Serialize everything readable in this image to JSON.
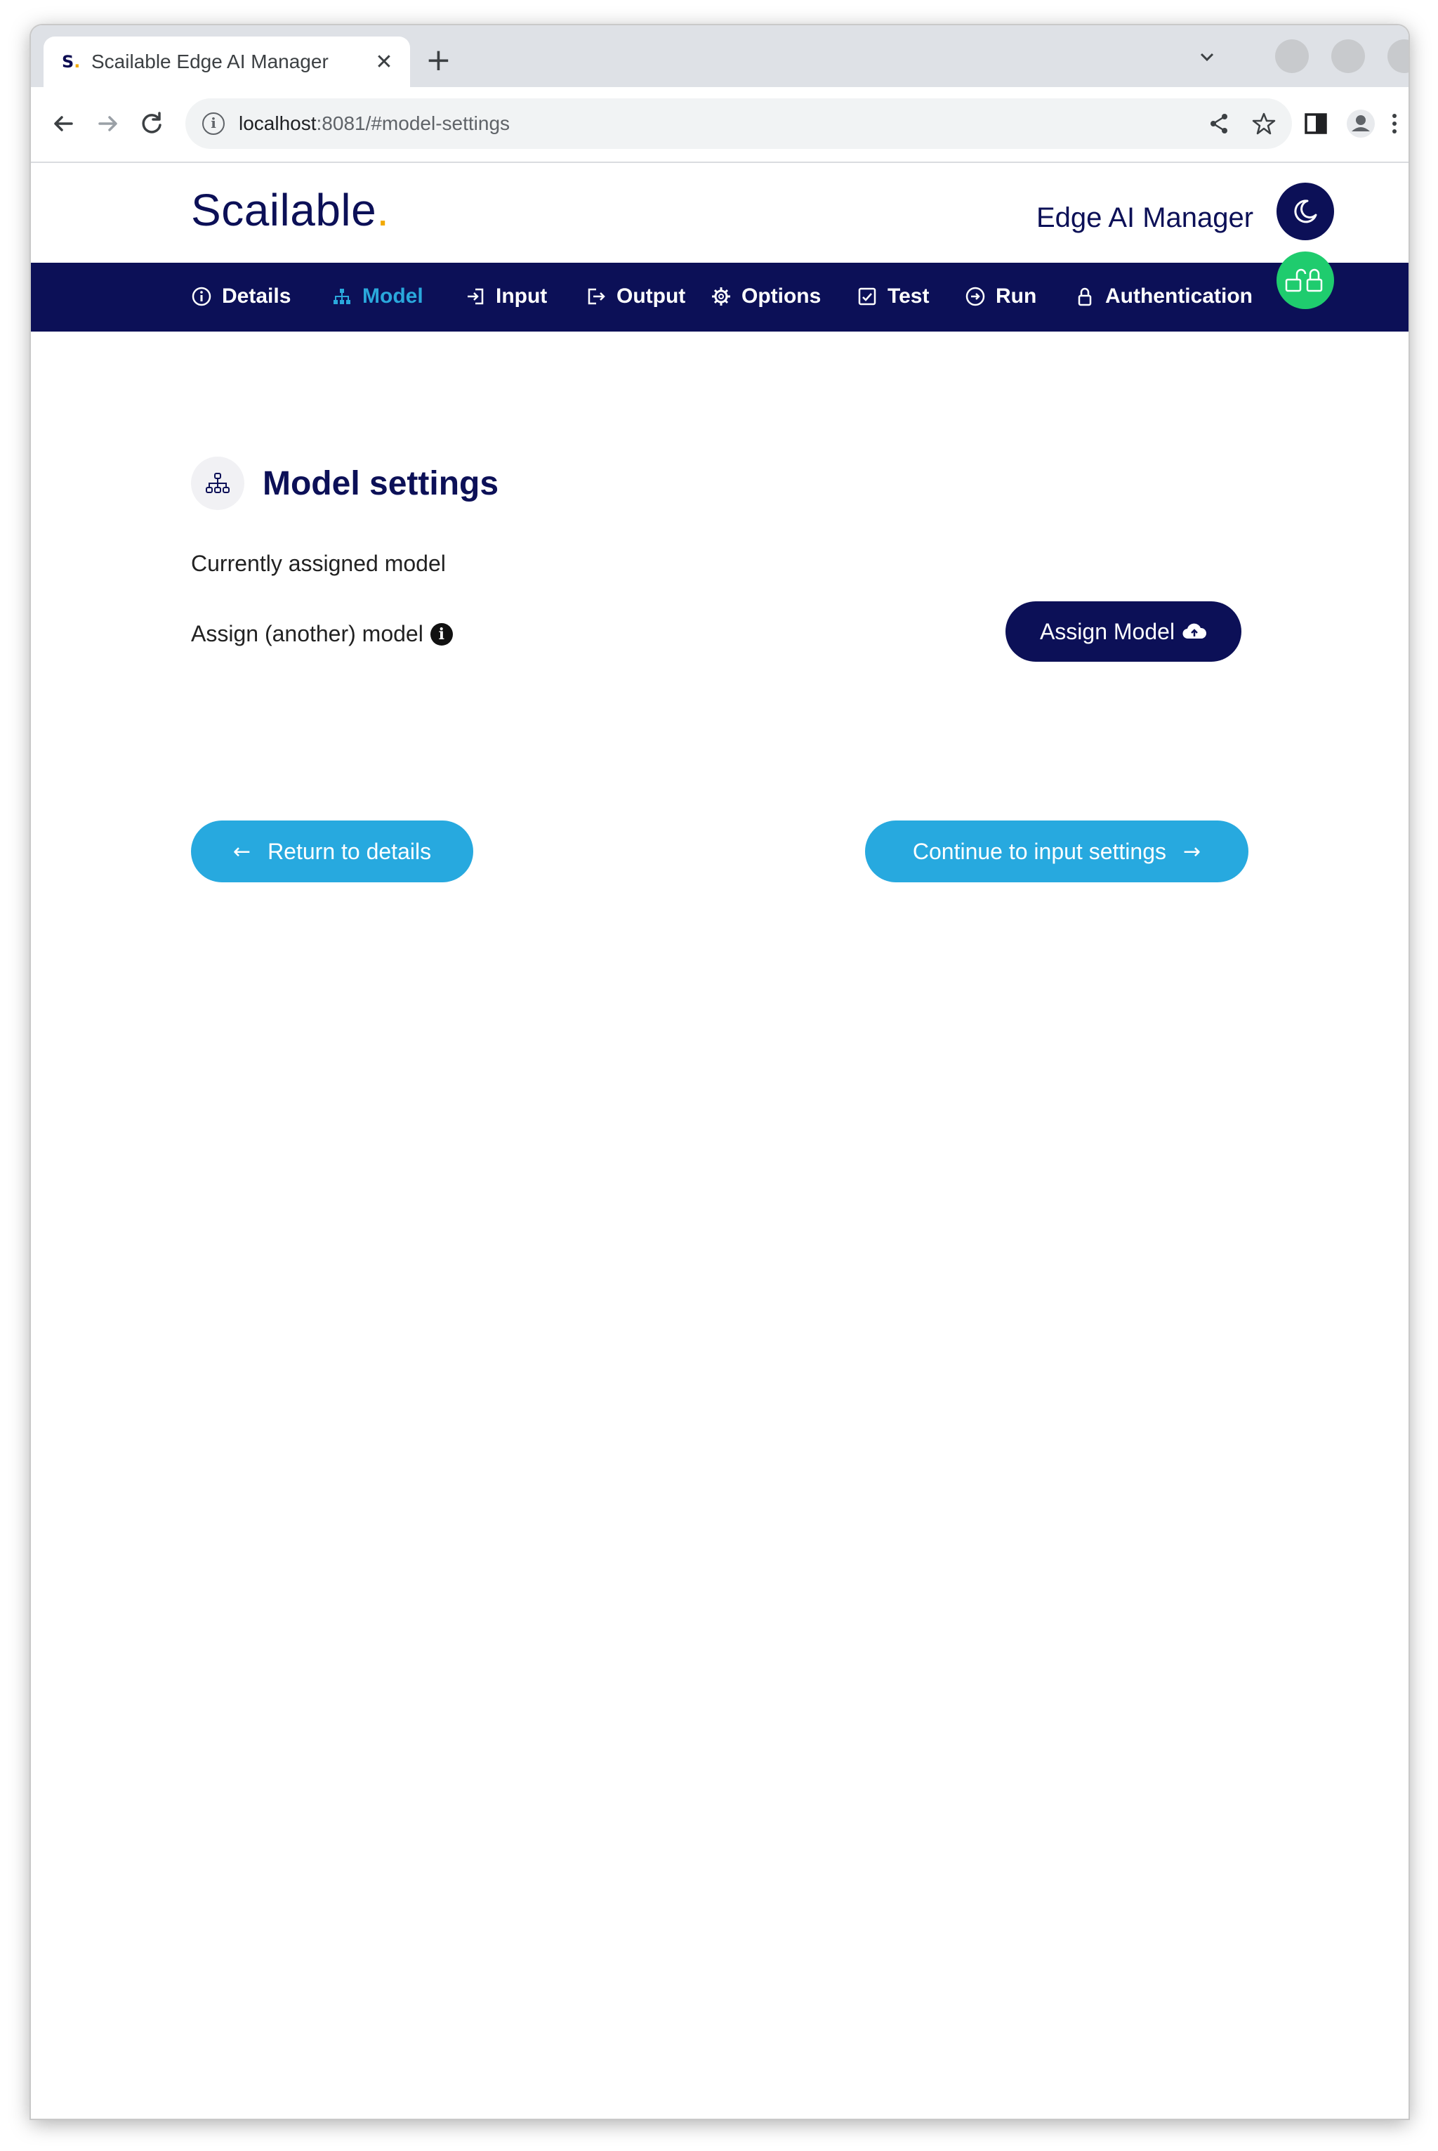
{
  "browser": {
    "tab": {
      "favicon": "S",
      "favicon_dot": ".",
      "title": "Scailable Edge AI Manager",
      "close": "✕"
    },
    "new_tab": "+",
    "url_host": "localhost",
    "url_rest": ":8081/#model-settings",
    "info_glyph": "i"
  },
  "header": {
    "logo_text": "Scailable",
    "logo_dot": ".",
    "product_title": "Edge AI Manager"
  },
  "nav": {
    "items": [
      {
        "label": "Details",
        "icon": "info-circle-icon"
      },
      {
        "label": "Model",
        "icon": "sitemap-icon",
        "active": true
      },
      {
        "label": "Input",
        "icon": "input-icon"
      },
      {
        "label": "Output",
        "icon": "output-icon"
      },
      {
        "label": "Options",
        "icon": "gear-icon"
      },
      {
        "label": "Test",
        "icon": "checklist-icon"
      },
      {
        "label": "Run",
        "icon": "arrow-circle-icon"
      },
      {
        "label": "Authentication",
        "icon": "lock-icon"
      }
    ]
  },
  "main": {
    "section_title": "Model settings",
    "assigned_label": "Currently assigned model",
    "assign_label": "Assign (another) model",
    "info_glyph": "i",
    "assign_button": "Assign Model",
    "back_button": "Return to details",
    "back_arrow": "←",
    "next_button": "Continue to input settings",
    "next_arrow": "→"
  },
  "colors": {
    "navy": "#0c1057",
    "accent": "#27a9df",
    "logo_dot": "#f2a900",
    "auth_badge": "#1fcc6e"
  }
}
